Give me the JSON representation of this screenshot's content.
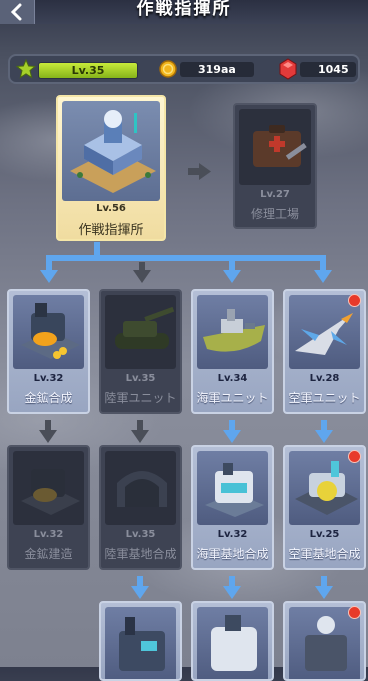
{
  "header": {
    "title": "作戦指揮所"
  },
  "resources": {
    "level": "Lv.35",
    "coins": "319aa",
    "gems": "1045"
  },
  "tree": {
    "root": {
      "level": "Lv.56",
      "label": "作戦指揮所"
    },
    "next": {
      "level": "Lv.27",
      "label": "修理工場"
    },
    "row1": [
      {
        "level": "Lv.32",
        "label": "金鉱合成",
        "state": "active"
      },
      {
        "level": "Lv.35",
        "label": "陸軍ユニット",
        "state": "dim"
      },
      {
        "level": "Lv.34",
        "label": "海軍ユニット",
        "state": "active"
      },
      {
        "level": "Lv.28",
        "label": "空軍ユニット",
        "state": "active",
        "badge": true
      }
    ],
    "row2": [
      {
        "level": "Lv.32",
        "label": "金鉱建造",
        "state": "dim"
      },
      {
        "level": "Lv.35",
        "label": "陸軍基地合成",
        "state": "dim"
      },
      {
        "level": "Lv.32",
        "label": "海軍基地合成",
        "state": "active"
      },
      {
        "level": "Lv.25",
        "label": "空軍基地合成",
        "state": "active",
        "badge": true
      }
    ]
  },
  "colors": {
    "accent_blue": "#5fa6ee",
    "arrow_gray": "#4a4e58",
    "badge_red": "#e83a2a",
    "level_green": "#a6d12a"
  }
}
